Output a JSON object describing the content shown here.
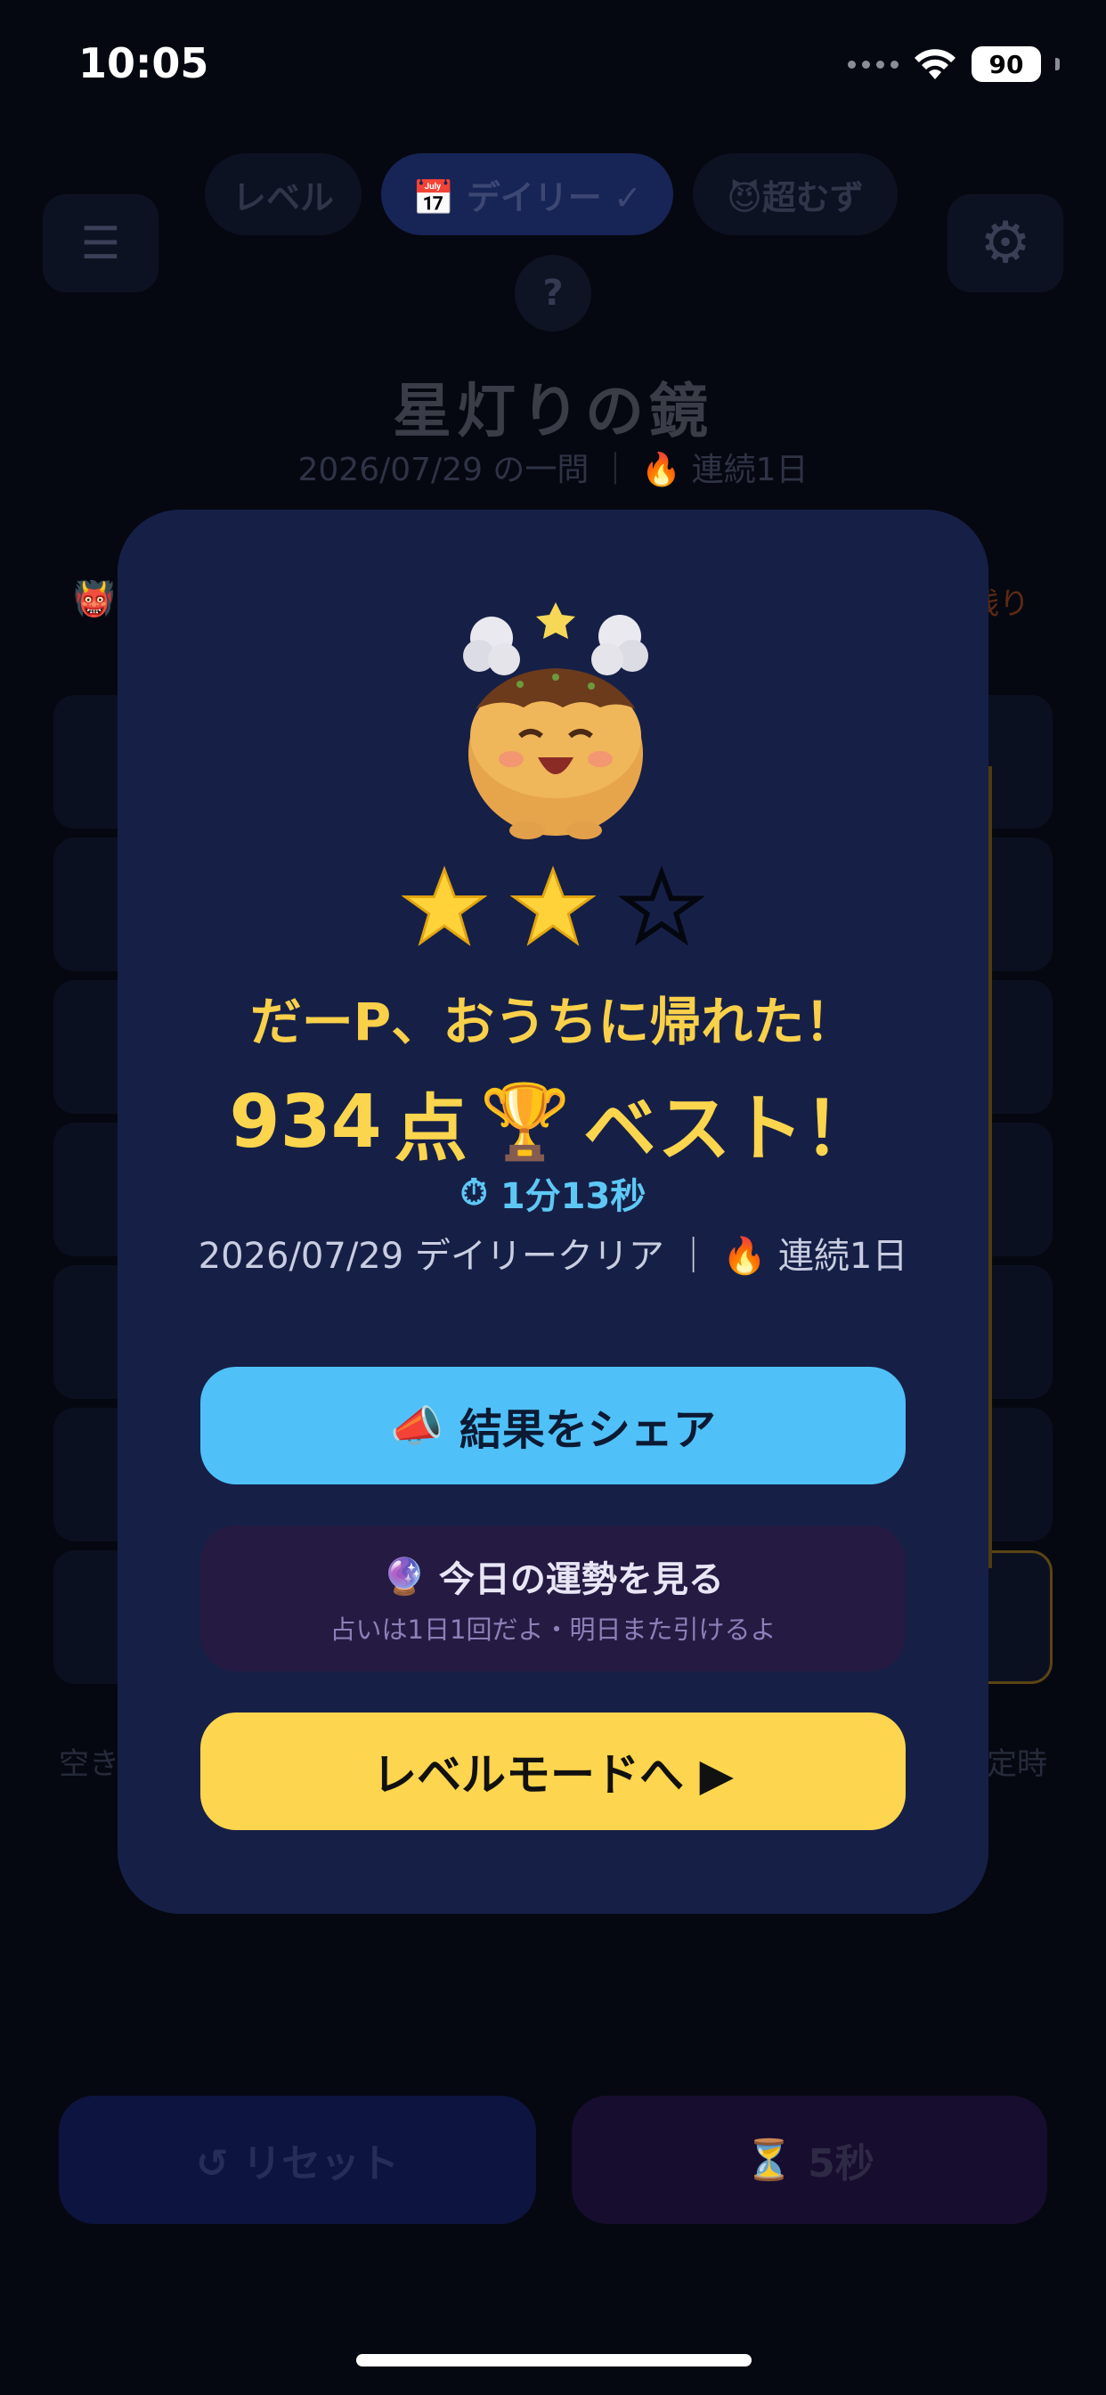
{
  "status_bar": {
    "time": "10:05",
    "battery": "90"
  },
  "mode_tabs": [
    {
      "label": "レベル"
    },
    {
      "label": "📅 デイリー ✓"
    },
    {
      "label": "😈超むず"
    }
  ],
  "header": {
    "menu_icon": "menu-icon",
    "settings_icon": "gear-icon",
    "help_label": "?",
    "puzzle_title": "星灯りの鏡",
    "puzzle_subtitle": "2026/07/29 の一問 ｜ 🔥 連続1日",
    "remaining_label": "残り"
  },
  "background_notes": {
    "left": "空き",
    "right": "定時"
  },
  "bottom_controls": {
    "reset_label": "↺ リセット",
    "timer_label": "5秒",
    "timer_icon": "hourglass-icon"
  },
  "modal": {
    "stars": {
      "earned": 2,
      "total": 3
    },
    "headline": "だーP、おうちに帰れた！",
    "score_value": "934",
    "score_unit": "点",
    "best_label": "ベスト！",
    "time_value": "1分13秒",
    "info": "2026/07/29 デイリークリア ｜ 🔥 連続1日",
    "share_label": "結果をシェア",
    "fortune_label": "今日の運勢を見る",
    "fortune_sub": "占いは1日1回だよ・明日また引けるよ",
    "level_label": "レベルモードへ ▶"
  },
  "colors": {
    "modal_bg": "#162047",
    "accent_yellow": "#fdd54e",
    "accent_blue": "#4fc1f8",
    "fortune_bg": "#241a42"
  }
}
